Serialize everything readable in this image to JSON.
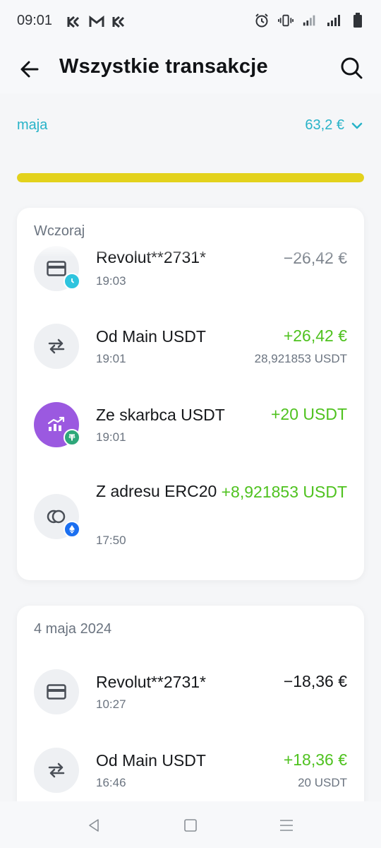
{
  "status_bar": {
    "time": "09:01",
    "left_icons": [
      "kuna-icon",
      "gmail-icon",
      "kuna-icon"
    ],
    "right_icons": [
      "alarm-icon",
      "vibrate-icon",
      "signal-lte-icon",
      "signal-icon",
      "battery-icon"
    ]
  },
  "header": {
    "title": "Wszystkie transakcje",
    "back_icon": "arrow-left-icon",
    "search_icon": "search-icon"
  },
  "budget": {
    "name": "maja",
    "amount": "63,2 €",
    "progress": 1.0,
    "accent_color": "#28b3c8",
    "bar_color": "#e3d21c"
  },
  "sections": [
    {
      "header": "Wczoraj",
      "transactions": [
        {
          "title": "Revolut**2731*",
          "time": "19:03",
          "amount": "−26,42 €",
          "sub": "",
          "icon": "card-icon",
          "badge": "clock-icon"
        },
        {
          "title": "Od Main USDT",
          "time": "19:01",
          "amount": "+26,42 €",
          "sub": "28,921853 USDT",
          "icon": "transfer-arrows-icon",
          "badge": ""
        },
        {
          "title": "Ze skarbca USDT",
          "time": "19:01",
          "amount": "+20 USDT",
          "sub": "",
          "icon": "vault-growth-icon",
          "badge": "tether-icon"
        },
        {
          "title": "Z adresu ERC20",
          "time": "17:50",
          "amount": "+8,921853 USDT",
          "sub": "",
          "icon": "coins-icon",
          "badge": "ethereum-icon"
        }
      ]
    },
    {
      "header": "4 maja 2024",
      "transactions": [
        {
          "title": "Revolut**2731*",
          "time": "10:27",
          "amount": "−18,36 €",
          "sub": "",
          "icon": "card-icon",
          "badge": ""
        },
        {
          "title": "Od Main USDT",
          "time": "16:46",
          "amount": "+18,36 €",
          "sub": "20 USDT",
          "icon": "transfer-arrows-icon",
          "badge": ""
        }
      ]
    }
  ],
  "nav": [
    "back-triangle-icon",
    "home-square-icon",
    "menu-lines-icon"
  ],
  "colors": {
    "positive": "#4fc21f",
    "vault_purple": "#9b59e0",
    "tether_green": "#2ea77a",
    "eth_blue": "#1b6ff0",
    "clock_cyan": "#2ec4de"
  }
}
